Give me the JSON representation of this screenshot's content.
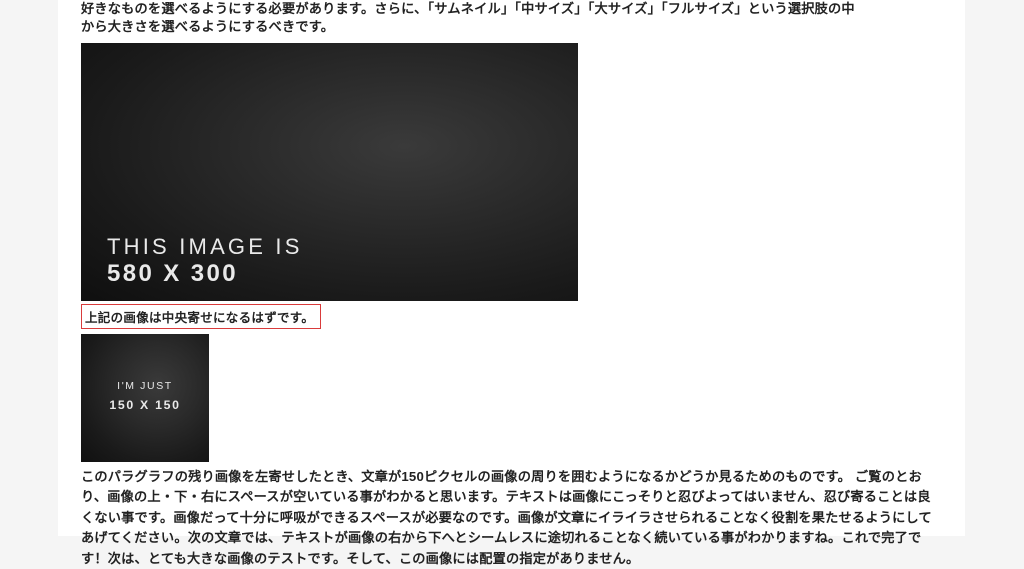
{
  "intro": {
    "line1_fragment": "好きなものを選べるようにする必要があります。さらに、「サムネイル」「中サイズ」「大サイズ」「フルサイズ」という選択肢の中",
    "line2_fragment": "から大きさを選べるようにするべきです。"
  },
  "image580": {
    "line1": "THIS IMAGE IS",
    "line2": "580 X 300"
  },
  "caption": "上記の画像は中央寄せになるはずです。",
  "image150": {
    "line1": "I'M JUST",
    "line2": "150 X 150"
  },
  "body": "このパラグラフの残り画像を左寄せしたとき、文章が150ピクセルの画像の周りを囲むようになるかどうか見るためのものです。 ご覧のとおり、画像の上・下・右にスペースが空いている事がわかると思います。テキストは画像にこっそりと忍びよってはいません、忍び寄ることは良くない事です。画像だって十分に呼吸ができるスペースが必要なのです。画像が文章にイライラさせられることなく役割を果たせるようにしてあげてください。次の文章では、テキストが画像の右から下へとシームレスに途切れることなく続いている事がわかりますね。これで完了です！次は、とても大きな画像のテストです。そして、この画像には配置の指定がありません。"
}
